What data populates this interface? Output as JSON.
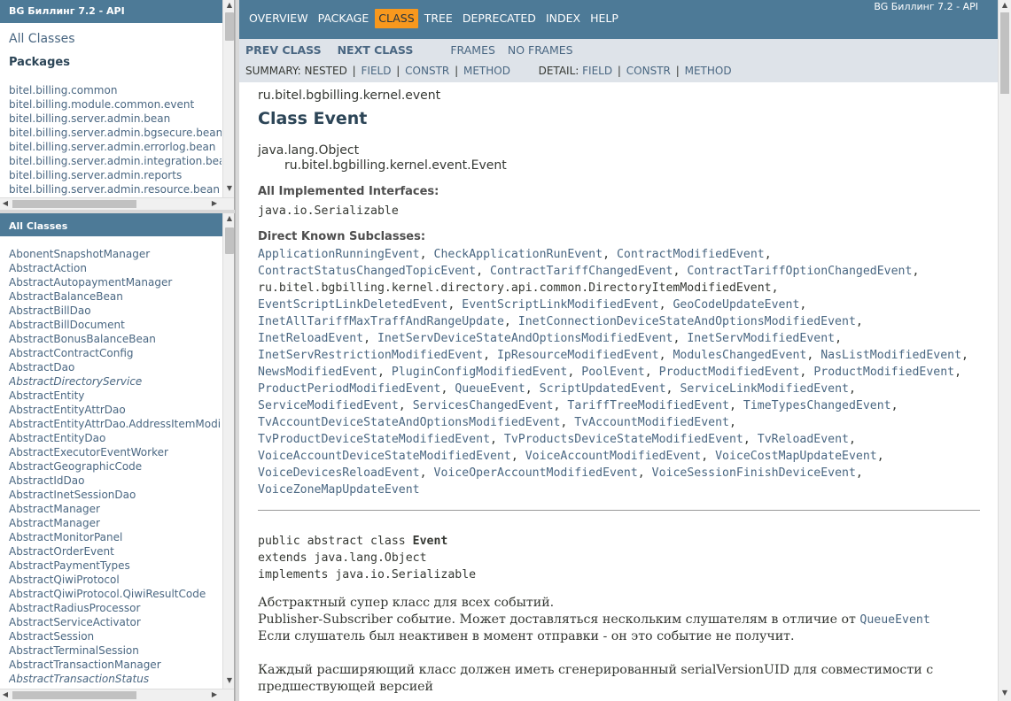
{
  "pkg_frame": {
    "title": "BG Биллинг 7.2 - API",
    "all_classes_link": "All Classes",
    "packages_heading": "Packages",
    "packages": [
      "bitel.billing.common",
      "bitel.billing.module.common.event",
      "bitel.billing.server.admin.bean",
      "bitel.billing.server.admin.bgsecure.bean",
      "bitel.billing.server.admin.errorlog.bean",
      "bitel.billing.server.admin.integration.bean",
      "bitel.billing.server.admin.reports",
      "bitel.billing.server.admin.resource.bean"
    ]
  },
  "class_frame": {
    "title": "All Classes",
    "classes": [
      {
        "name": "AbonentSnapshotManager",
        "italic": false
      },
      {
        "name": "AbstractAction",
        "italic": false
      },
      {
        "name": "AbstractAutopaymentManager",
        "italic": false
      },
      {
        "name": "AbstractBalanceBean",
        "italic": false
      },
      {
        "name": "AbstractBillDao",
        "italic": false
      },
      {
        "name": "AbstractBillDocument",
        "italic": false
      },
      {
        "name": "AbstractBonusBalanceBean",
        "italic": false
      },
      {
        "name": "AbstractContractConfig",
        "italic": false
      },
      {
        "name": "AbstractDao",
        "italic": false
      },
      {
        "name": "AbstractDirectoryService",
        "italic": true
      },
      {
        "name": "AbstractEntity",
        "italic": false
      },
      {
        "name": "AbstractEntityAttrDao",
        "italic": false
      },
      {
        "name": "AbstractEntityAttrDao.AddressItemModi",
        "italic": false
      },
      {
        "name": "AbstractEntityDao",
        "italic": false
      },
      {
        "name": "AbstractExecutorEventWorker",
        "italic": false
      },
      {
        "name": "AbstractGeographicCode",
        "italic": false
      },
      {
        "name": "AbstractIdDao",
        "italic": false
      },
      {
        "name": "AbstractInetSessionDao",
        "italic": false
      },
      {
        "name": "AbstractManager",
        "italic": false
      },
      {
        "name": "AbstractManager",
        "italic": false
      },
      {
        "name": "AbstractMonitorPanel",
        "italic": false
      },
      {
        "name": "AbstractOrderEvent",
        "italic": false
      },
      {
        "name": "AbstractPaymentTypes",
        "italic": false
      },
      {
        "name": "AbstractQiwiProtocol",
        "italic": false
      },
      {
        "name": "AbstractQiwiProtocol.QiwiResultCode",
        "italic": false
      },
      {
        "name": "AbstractRadiusProcessor",
        "italic": false
      },
      {
        "name": "AbstractServiceActivator",
        "italic": false
      },
      {
        "name": "AbstractSession",
        "italic": false
      },
      {
        "name": "AbstractTerminalSession",
        "italic": false
      },
      {
        "name": "AbstractTransactionManager",
        "italic": false
      },
      {
        "name": "AbstractTransactionStatus",
        "italic": true
      }
    ]
  },
  "topnav": {
    "items": [
      "OVERVIEW",
      "PACKAGE",
      "CLASS",
      "TREE",
      "DEPRECATED",
      "INDEX",
      "HELP"
    ],
    "active": "CLASS",
    "about": "BG Биллинг 7.2 - API"
  },
  "subnav": {
    "prev_class": "PREV CLASS",
    "next_class": "NEXT CLASS",
    "frames": "FRAMES",
    "no_frames": "NO FRAMES",
    "summary_label": "SUMMARY: NESTED",
    "summary_links": [
      "FIELD",
      "CONSTR",
      "METHOD"
    ],
    "detail_label": "DETAIL:",
    "detail_links": [
      "FIELD",
      "CONSTR",
      "METHOD"
    ],
    "separator": "|"
  },
  "content": {
    "package": "ru.bitel.bgbilling.kernel.event",
    "class_title": "Class Event",
    "inherit_root": "java.lang.Object",
    "inherit_class": "ru.bitel.bgbilling.kernel.event.Event",
    "interfaces_heading": "All Implemented Interfaces:",
    "interfaces": "java.io.Serializable",
    "subclasses_heading": "Direct Known Subclasses:",
    "subclasses": [
      {
        "name": "ApplicationRunningEvent",
        "link": true
      },
      {
        "name": "CheckApplicationRunEvent",
        "link": true
      },
      {
        "name": "ContractModifiedEvent",
        "link": true
      },
      {
        "name": "ContractStatusChangedTopicEvent",
        "link": true
      },
      {
        "name": "ContractTariffChangedEvent",
        "link": true
      },
      {
        "name": "ContractTariffOptionChangedEvent",
        "link": true
      },
      {
        "name": "ru.bitel.bgbilling.kernel.directory.api.common.DirectoryItemModifiedEvent",
        "link": false
      },
      {
        "name": "EventScriptLinkDeletedEvent",
        "link": true
      },
      {
        "name": "EventScriptLinkModifiedEvent",
        "link": true
      },
      {
        "name": "GeoCodeUpdateEvent",
        "link": true
      },
      {
        "name": "InetAllTariffMaxTraffAndRangeUpdate",
        "link": true
      },
      {
        "name": "InetConnectionDeviceStateAndOptionsModifiedEvent",
        "link": true
      },
      {
        "name": "InetReloadEvent",
        "link": true
      },
      {
        "name": "InetServDeviceStateAndOptionsModifiedEvent",
        "link": true
      },
      {
        "name": "InetServModifiedEvent",
        "link": true
      },
      {
        "name": "InetServRestrictionModifiedEvent",
        "link": true
      },
      {
        "name": "IpResourceModifiedEvent",
        "link": true
      },
      {
        "name": "ModulesChangedEvent",
        "link": true
      },
      {
        "name": "NasListModifiedEvent",
        "link": true
      },
      {
        "name": "NewsModifiedEvent",
        "link": true
      },
      {
        "name": "PluginConfigModifiedEvent",
        "link": true
      },
      {
        "name": "PoolEvent",
        "link": true
      },
      {
        "name": "ProductModifiedEvent",
        "link": true
      },
      {
        "name": "ProductModifiedEvent",
        "link": true
      },
      {
        "name": "ProductPeriodModifiedEvent",
        "link": true
      },
      {
        "name": "QueueEvent",
        "link": true
      },
      {
        "name": "ScriptUpdatedEvent",
        "link": true
      },
      {
        "name": "ServiceLinkModifiedEvent",
        "link": true
      },
      {
        "name": "ServiceModifiedEvent",
        "link": true
      },
      {
        "name": "ServicesChangedEvent",
        "link": true
      },
      {
        "name": "TariffTreeModifiedEvent",
        "link": true
      },
      {
        "name": "TimeTypesChangedEvent",
        "link": true
      },
      {
        "name": "TvAccountDeviceStateAndOptionsModifiedEvent",
        "link": true
      },
      {
        "name": "TvAccountModifiedEvent",
        "link": true
      },
      {
        "name": "TvProductDeviceStateModifiedEvent",
        "link": true
      },
      {
        "name": "TvProductsDeviceStateModifiedEvent",
        "link": true
      },
      {
        "name": "TvReloadEvent",
        "link": true
      },
      {
        "name": "VoiceAccountDeviceStateModifiedEvent",
        "link": true
      },
      {
        "name": "VoiceAccountModifiedEvent",
        "link": true
      },
      {
        "name": "VoiceCostMapUpdateEvent",
        "link": true
      },
      {
        "name": "VoiceDevicesReloadEvent",
        "link": true
      },
      {
        "name": "VoiceOperAccountModifiedEvent",
        "link": true
      },
      {
        "name": "VoiceSessionFinishDeviceEvent",
        "link": true
      },
      {
        "name": "VoiceZoneMapUpdateEvent",
        "link": true
      }
    ],
    "signature": {
      "prefix": "public abstract class ",
      "name": "Event",
      "extends": "extends java.lang.Object",
      "implements": "implements java.io.Serializable"
    },
    "description": {
      "line1": "Абстрактный супер класс для всех событий.",
      "line2_prefix": "Publisher-Subscriber событие. Может доставляться нескольким слушателям в отличие от ",
      "line2_link": "QueueEvent",
      "line3": "Если слушатель был неактивен в момент отправки - он это событие не получит.",
      "para2": "Каждый расширяющий класс должен иметь сгенерированный serialVersionUID для совместимости с",
      "para2_cont": "предшествующей версией"
    }
  },
  "colors": {
    "nav_bg": "#4d7a97",
    "subnav_bg": "#dee3e9",
    "active_tab": "#f8981d",
    "link": "#4a6782",
    "title": "#2c4557"
  }
}
